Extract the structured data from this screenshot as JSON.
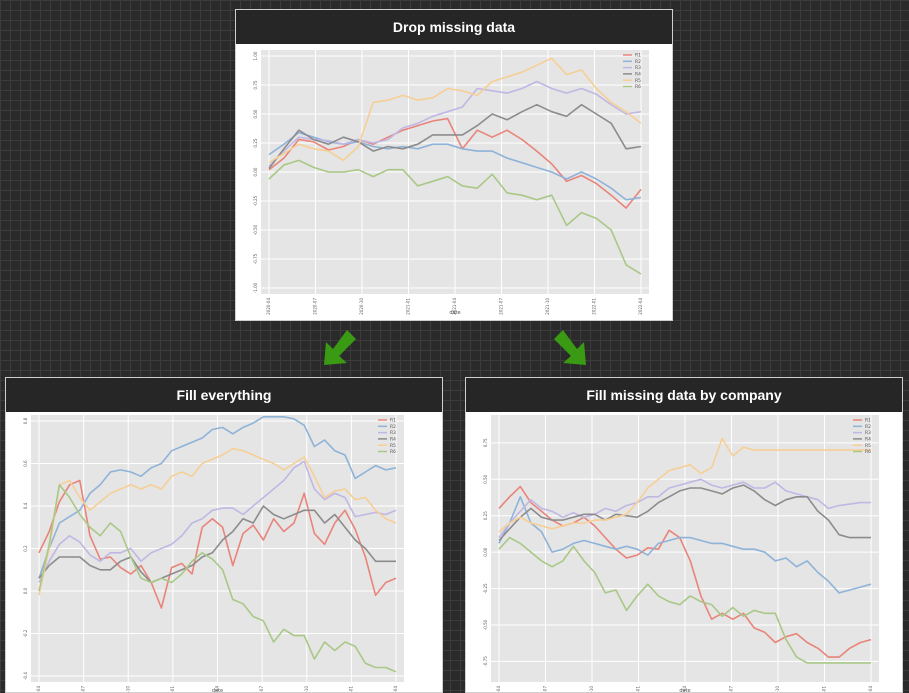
{
  "panels": {
    "top": {
      "title": "Drop missing data"
    },
    "left": {
      "title": "Fill everything"
    },
    "right": {
      "title": "Fill missing data by company"
    }
  },
  "colors": {
    "R1": "#e8847a",
    "R2": "#8fb3d8",
    "R3": "#c0b7e4",
    "R4": "#8c8c8c",
    "R5": "#f6cf95",
    "R6": "#a9c886",
    "arrow": "#3a9a14",
    "plot_bg": "#e5e5e5"
  },
  "chart_data": [
    {
      "type": "line",
      "panel": "top",
      "title": "Drop missing data",
      "xlabel": "date",
      "ylabel": "",
      "xticks": [
        "2020-04",
        "2020-07",
        "2020-10",
        "2021-01",
        "2021-04",
        "2021-07",
        "2021-10",
        "2022-01",
        "2022-04"
      ],
      "yticks": [
        "-1.00",
        "-0.75",
        "-0.50",
        "-0.25",
        "0.00",
        "0.25",
        "0.50",
        "0.75",
        "1.00"
      ],
      "ylim": [
        -1.0,
        1.0
      ],
      "legend": "top-right",
      "grid": true,
      "x": [
        0,
        1,
        2,
        3,
        4,
        5,
        6,
        7,
        8,
        9,
        10,
        11,
        12,
        13,
        14,
        15,
        16,
        17,
        18,
        19,
        20,
        21,
        22,
        23,
        24,
        25
      ],
      "series": [
        {
          "name": "R1",
          "values": [
            0.02,
            0.12,
            0.28,
            0.26,
            0.19,
            0.22,
            0.28,
            0.24,
            0.3,
            0.36,
            0.4,
            0.44,
            0.46,
            0.2,
            0.36,
            0.3,
            0.36,
            0.28,
            0.18,
            0.07,
            -0.08,
            -0.03,
            -0.1,
            -0.2,
            -0.31,
            -0.15
          ]
        },
        {
          "name": "R2",
          "values": [
            0.15,
            0.24,
            0.34,
            0.3,
            0.26,
            0.24,
            0.26,
            0.22,
            0.2,
            0.22,
            0.2,
            0.24,
            0.24,
            0.2,
            0.18,
            0.18,
            0.12,
            0.08,
            0.04,
            0.0,
            -0.06,
            0.0,
            -0.06,
            -0.14,
            -0.24,
            -0.22
          ]
        },
        {
          "name": "R3",
          "values": [
            0.05,
            0.18,
            0.3,
            0.28,
            0.27,
            0.24,
            0.28,
            0.25,
            0.28,
            0.38,
            0.42,
            0.48,
            0.52,
            0.56,
            0.72,
            0.7,
            0.68,
            0.72,
            0.78,
            0.72,
            0.68,
            0.72,
            0.67,
            0.58,
            0.5,
            0.52
          ]
        },
        {
          "name": "R4",
          "values": [
            0.03,
            0.2,
            0.36,
            0.28,
            0.24,
            0.3,
            0.26,
            0.18,
            0.22,
            0.2,
            0.24,
            0.32,
            0.32,
            0.32,
            0.4,
            0.5,
            0.45,
            0.52,
            0.58,
            0.52,
            0.48,
            0.58,
            0.5,
            0.42,
            0.2,
            0.22
          ]
        },
        {
          "name": "R5",
          "values": [
            0.08,
            0.16,
            0.24,
            0.2,
            0.18,
            0.1,
            0.22,
            0.6,
            0.62,
            0.66,
            0.62,
            0.64,
            0.72,
            0.7,
            0.66,
            0.78,
            0.82,
            0.86,
            0.92,
            0.98,
            0.84,
            0.88,
            0.72,
            0.6,
            0.52,
            0.42
          ]
        },
        {
          "name": "R6",
          "values": [
            -0.06,
            0.06,
            0.1,
            0.04,
            0.0,
            0.0,
            0.02,
            -0.04,
            0.02,
            0.02,
            -0.12,
            -0.08,
            -0.04,
            -0.12,
            -0.14,
            -0.02,
            -0.18,
            -0.2,
            -0.24,
            -0.2,
            -0.46,
            -0.35,
            -0.4,
            -0.5,
            -0.8,
            -0.88
          ]
        }
      ]
    },
    {
      "type": "line",
      "panel": "left",
      "title": "Fill everything",
      "xlabel": "date",
      "ylabel": "",
      "xticks": [
        "2020-04",
        "2020-07",
        "2020-10",
        "2021-01",
        "2021-04",
        "2021-07",
        "2021-10",
        "2022-01",
        "2022-04"
      ],
      "yticks": [
        "-0.4",
        "-0.2",
        "0.0",
        "0.2",
        "0.4",
        "0.6",
        "0.8"
      ],
      "ylim": [
        -0.4,
        0.8
      ],
      "legend": "top-right",
      "grid": true,
      "x": [
        0,
        1,
        2,
        3,
        4,
        5,
        6,
        7,
        8,
        9,
        10,
        11,
        12,
        13,
        14,
        15,
        16,
        17,
        18,
        19,
        20,
        21,
        22,
        23,
        24,
        25,
        26,
        27,
        28,
        29,
        30,
        31,
        32,
        33,
        34,
        35
      ],
      "series": [
        {
          "name": "R1",
          "values": [
            0.18,
            0.28,
            0.42,
            0.5,
            0.52,
            0.26,
            0.15,
            0.16,
            0.11,
            0.08,
            0.12,
            0.04,
            -0.08,
            0.11,
            0.13,
            0.08,
            0.3,
            0.34,
            0.3,
            0.12,
            0.27,
            0.31,
            0.24,
            0.34,
            0.28,
            0.32,
            0.46,
            0.27,
            0.22,
            0.32,
            0.38,
            0.29,
            0.16,
            -0.02,
            0.04,
            0.06
          ]
        },
        {
          "name": "R2",
          "values": [
            0.06,
            0.2,
            0.32,
            0.35,
            0.38,
            0.46,
            0.5,
            0.56,
            0.57,
            0.56,
            0.54,
            0.58,
            0.6,
            0.66,
            0.68,
            0.7,
            0.72,
            0.76,
            0.77,
            0.74,
            0.77,
            0.79,
            0.82,
            0.82,
            0.82,
            0.81,
            0.78,
            0.68,
            0.71,
            0.66,
            0.64,
            0.53,
            0.56,
            0.59,
            0.57,
            0.58
          ]
        },
        {
          "name": "R3",
          "values": [
            0.04,
            0.14,
            0.22,
            0.26,
            0.23,
            0.17,
            0.14,
            0.18,
            0.18,
            0.2,
            0.14,
            0.18,
            0.2,
            0.22,
            0.26,
            0.32,
            0.34,
            0.38,
            0.39,
            0.39,
            0.36,
            0.4,
            0.44,
            0.48,
            0.52,
            0.58,
            0.61,
            0.48,
            0.43,
            0.46,
            0.44,
            0.35,
            0.36,
            0.37,
            0.36,
            0.38
          ]
        },
        {
          "name": "R4",
          "values": [
            0.06,
            0.12,
            0.16,
            0.16,
            0.16,
            0.12,
            0.1,
            0.1,
            0.14,
            0.16,
            0.09,
            0.04,
            0.06,
            0.08,
            0.1,
            0.12,
            0.16,
            0.18,
            0.24,
            0.28,
            0.34,
            0.32,
            0.4,
            0.36,
            0.34,
            0.36,
            0.38,
            0.38,
            0.32,
            0.36,
            0.3,
            0.24,
            0.2,
            0.14,
            0.14,
            0.14
          ]
        },
        {
          "name": "R5",
          "values": [
            -0.02,
            0.2,
            0.5,
            0.52,
            0.44,
            0.38,
            0.42,
            0.46,
            0.48,
            0.5,
            0.48,
            0.5,
            0.48,
            0.54,
            0.56,
            0.54,
            0.6,
            0.62,
            0.64,
            0.67,
            0.66,
            0.64,
            0.62,
            0.6,
            0.57,
            0.6,
            0.63,
            0.54,
            0.44,
            0.47,
            0.48,
            0.43,
            0.44,
            0.38,
            0.34,
            0.32
          ]
        },
        {
          "name": "R6",
          "values": [
            0.0,
            0.22,
            0.5,
            0.44,
            0.36,
            0.3,
            0.26,
            0.32,
            0.28,
            0.16,
            0.06,
            0.04,
            0.06,
            0.04,
            0.08,
            0.14,
            0.18,
            0.15,
            0.1,
            -0.04,
            -0.06,
            -0.12,
            -0.14,
            -0.24,
            -0.18,
            -0.21,
            -0.21,
            -0.32,
            -0.24,
            -0.28,
            -0.24,
            -0.26,
            -0.34,
            -0.36,
            -0.36,
            -0.38
          ]
        }
      ]
    },
    {
      "type": "line",
      "panel": "right",
      "title": "Fill missing data by company",
      "xlabel": "date",
      "ylabel": "",
      "xticks": [
        "2020-04",
        "2020-07",
        "2020-10",
        "2021-01",
        "2021-04",
        "2021-07",
        "2021-10",
        "2022-01",
        "2022-04"
      ],
      "yticks": [
        "-0.75",
        "-0.50",
        "-0.25",
        "0.00",
        "0.25",
        "0.50",
        "0.75"
      ],
      "ylim": [
        -0.85,
        0.9
      ],
      "legend": "top-right",
      "grid": true,
      "x": [
        0,
        1,
        2,
        3,
        4,
        5,
        6,
        7,
        8,
        9,
        10,
        11,
        12,
        13,
        14,
        15,
        16,
        17,
        18,
        19,
        20,
        21,
        22,
        23,
        24,
        25,
        26,
        27,
        28,
        29,
        30,
        31,
        32,
        33,
        34,
        35
      ],
      "series": [
        {
          "name": "R1",
          "values": [
            0.3,
            0.38,
            0.45,
            0.34,
            0.28,
            0.22,
            0.18,
            0.2,
            0.24,
            0.18,
            0.1,
            0.02,
            -0.04,
            -0.02,
            0.03,
            0.02,
            0.15,
            0.1,
            -0.06,
            -0.3,
            -0.46,
            -0.42,
            -0.46,
            -0.42,
            -0.52,
            -0.55,
            -0.62,
            -0.58,
            -0.56,
            -0.62,
            -0.66,
            -0.72,
            -0.72,
            -0.66,
            -0.62,
            -0.6
          ]
        },
        {
          "name": "R2",
          "values": [
            0.06,
            0.2,
            0.38,
            0.2,
            0.14,
            0.0,
            0.02,
            0.06,
            0.08,
            0.06,
            0.04,
            0.02,
            0.04,
            0.02,
            -0.02,
            0.06,
            0.08,
            0.1,
            0.1,
            0.08,
            0.06,
            0.06,
            0.04,
            0.02,
            0.02,
            0.0,
            -0.06,
            -0.04,
            -0.1,
            -0.06,
            -0.14,
            -0.2,
            -0.28,
            -0.26,
            -0.24,
            -0.22
          ]
        },
        {
          "name": "R3",
          "values": [
            0.1,
            0.2,
            0.28,
            0.36,
            0.3,
            0.28,
            0.24,
            0.27,
            0.24,
            0.26,
            0.3,
            0.28,
            0.32,
            0.34,
            0.38,
            0.38,
            0.44,
            0.46,
            0.48,
            0.5,
            0.46,
            0.44,
            0.46,
            0.48,
            0.44,
            0.44,
            0.48,
            0.42,
            0.4,
            0.38,
            0.36,
            0.3,
            0.32,
            0.33,
            0.34,
            0.34
          ]
        },
        {
          "name": "R4",
          "values": [
            0.08,
            0.16,
            0.24,
            0.3,
            0.24,
            0.22,
            0.22,
            0.24,
            0.26,
            0.26,
            0.22,
            0.26,
            0.25,
            0.24,
            0.28,
            0.34,
            0.38,
            0.42,
            0.44,
            0.44,
            0.42,
            0.4,
            0.44,
            0.46,
            0.42,
            0.36,
            0.32,
            0.36,
            0.38,
            0.38,
            0.28,
            0.22,
            0.12,
            0.1,
            0.1,
            0.1
          ]
        },
        {
          "name": "R5",
          "values": [
            0.14,
            0.2,
            0.24,
            0.2,
            0.18,
            0.16,
            0.18,
            0.2,
            0.2,
            0.22,
            0.22,
            0.24,
            0.26,
            0.34,
            0.44,
            0.5,
            0.56,
            0.58,
            0.6,
            0.54,
            0.58,
            0.78,
            0.66,
            0.72,
            0.7,
            0.7,
            0.7,
            0.7,
            0.7,
            0.7,
            0.7,
            0.7,
            0.7,
            0.7,
            0.7,
            0.7
          ]
        },
        {
          "name": "R6",
          "values": [
            0.02,
            0.1,
            0.06,
            0.0,
            -0.06,
            -0.1,
            -0.06,
            0.04,
            -0.06,
            -0.14,
            -0.28,
            -0.26,
            -0.4,
            -0.3,
            -0.22,
            -0.3,
            -0.34,
            -0.36,
            -0.3,
            -0.34,
            -0.36,
            -0.44,
            -0.38,
            -0.44,
            -0.4,
            -0.42,
            -0.42,
            -0.6,
            -0.72,
            -0.76,
            -0.76,
            -0.76,
            -0.76,
            -0.76,
            -0.76,
            -0.76
          ]
        }
      ]
    }
  ]
}
